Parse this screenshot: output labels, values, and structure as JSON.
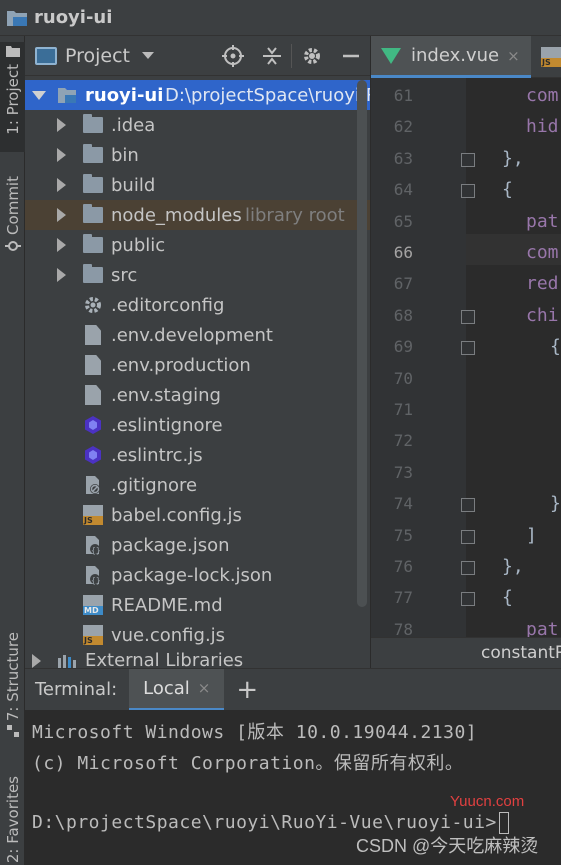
{
  "window": {
    "title": "ruoyi-ui"
  },
  "left_strip": {
    "tabs": [
      {
        "label": "1: Project"
      },
      {
        "label": "Commit"
      },
      {
        "label": "7: Structure"
      },
      {
        "label": "2: Favorites"
      }
    ]
  },
  "project_panel": {
    "title": "Project",
    "tools": [
      "locate-icon",
      "collapse-icon",
      "settings-icon",
      "minimize-icon"
    ],
    "tree": [
      {
        "name": "ruoyi-ui",
        "sub": "D:\\projectSpace\\ruoyi\\Ru",
        "type": "root"
      },
      {
        "name": ".idea",
        "type": "folder"
      },
      {
        "name": "bin",
        "type": "folder"
      },
      {
        "name": "build",
        "type": "folder"
      },
      {
        "name": "node_modules",
        "sub": "library root",
        "type": "folder"
      },
      {
        "name": "public",
        "type": "folder"
      },
      {
        "name": "src",
        "type": "folder"
      },
      {
        "name": ".editorconfig",
        "type": "gear"
      },
      {
        "name": ".env.development",
        "type": "file"
      },
      {
        "name": ".env.production",
        "type": "file"
      },
      {
        "name": ".env.staging",
        "type": "file"
      },
      {
        "name": ".eslintignore",
        "type": "eslint"
      },
      {
        "name": ".eslintrc.js",
        "type": "eslint"
      },
      {
        "name": ".gitignore",
        "type": "gitignore"
      },
      {
        "name": "babel.config.js",
        "type": "js"
      },
      {
        "name": "package.json",
        "type": "json"
      },
      {
        "name": "package-lock.json",
        "type": "json"
      },
      {
        "name": "README.md",
        "type": "md"
      },
      {
        "name": "vue.config.js",
        "type": "js"
      },
      {
        "name": "External Libraries",
        "type": "libs"
      }
    ]
  },
  "editor": {
    "tabs": [
      {
        "label": "index.vue",
        "close": "×"
      }
    ],
    "line_numbers": [
      "61",
      "62",
      "63",
      "64",
      "65",
      "66",
      "67",
      "68",
      "69",
      "70",
      "71",
      "72",
      "73",
      "74",
      "75",
      "76",
      "77",
      "78"
    ],
    "current_line": "66",
    "lines": {
      "l61": "com",
      "l62": "hid",
      "l63": "},",
      "l64": "{",
      "l65": "pat",
      "l66": "com",
      "l67": "red",
      "l68": "chi",
      "l69": "{",
      "l74": "}",
      "l75": "]",
      "l76": "},",
      "l77": "{",
      "l78": "pat"
    },
    "breadcrumb": "constantR"
  },
  "terminal": {
    "title": "Terminal:",
    "tab": "Local",
    "close": "×",
    "add": "+",
    "lines": [
      "Microsoft Windows [版本 10.0.19044.2130]",
      "(c) Microsoft Corporation。保留所有权利。",
      "",
      "D:\\projectSpace\\ruoyi\\RuoYi-Vue\\ruoyi-ui>"
    ]
  },
  "watermark": {
    "site": "Yuucn.com",
    "author": "CSDN @今天吃麻辣烫"
  }
}
